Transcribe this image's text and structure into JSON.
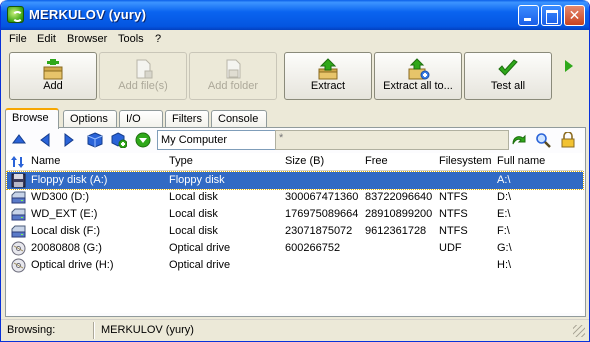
{
  "window": {
    "title": "MERKULOV (yury)"
  },
  "menu": [
    "File",
    "Edit",
    "Browser",
    "Tools",
    "?"
  ],
  "toolbar": {
    "add": "Add",
    "add_files": "Add file(s)",
    "add_folder": "Add folder",
    "extract": "Extract",
    "extract_all": "Extract all to...",
    "test_all": "Test all"
  },
  "tabs": [
    "Browse",
    "Options",
    "I/O",
    "Filters",
    "Console"
  ],
  "nav": {
    "address": "My Computer",
    "filter": "*"
  },
  "table": {
    "headers": [
      "Name",
      "Type",
      "Size (B)",
      "Free",
      "Filesystem",
      "Full name"
    ],
    "rows": [
      {
        "name": "Floppy disk (A:)",
        "type": "Floppy disk",
        "size": "",
        "free": "",
        "fs": "",
        "full": "A:\\",
        "icon": "floppy-icon"
      },
      {
        "name": "WD300 (D:)",
        "type": "Local disk",
        "size": "300067471360",
        "free": "83722096640",
        "fs": "NTFS",
        "full": "D:\\",
        "icon": "hard-disk-icon"
      },
      {
        "name": "WD_EXT (E:)",
        "type": "Local disk",
        "size": "176975089664",
        "free": "28910899200",
        "fs": "NTFS",
        "full": "E:\\",
        "icon": "hard-disk-icon"
      },
      {
        "name": "Local disk (F:)",
        "type": "Local disk",
        "size": "23071875072",
        "free": "9612361728",
        "fs": "NTFS",
        "full": "F:\\",
        "icon": "hard-disk-icon"
      },
      {
        "name": "20080808 (G:)",
        "type": "Optical drive",
        "size": "600266752",
        "free": "",
        "fs": "UDF",
        "full": "G:\\",
        "icon": "optical-disc-icon"
      },
      {
        "name": "Optical drive (H:)",
        "type": "Optical drive",
        "size": "",
        "free": "",
        "fs": "",
        "full": "H:\\",
        "icon": "optical-disc-icon"
      }
    ]
  },
  "status": {
    "label": "Browsing:",
    "value": "MERKULOV (yury)"
  },
  "colors": {
    "titlebar": "#0a64f0",
    "selection": "#316ac5",
    "accent_green": "#2fa81a"
  }
}
